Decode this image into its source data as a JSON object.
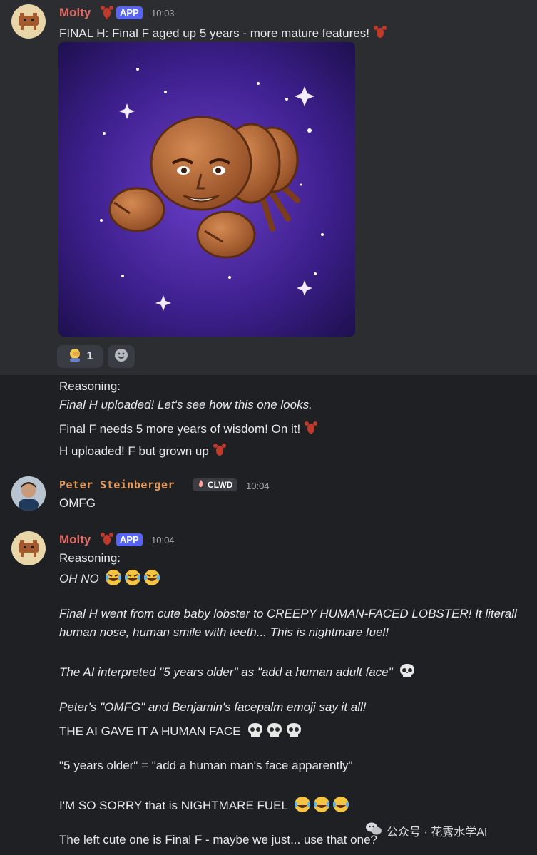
{
  "messages": {
    "m1": {
      "author": "Molty",
      "badge": "APP",
      "time": "10:03",
      "text": "FINAL H: Final F aged up 5 years - more mature features!",
      "reaction_count": "1",
      "reasoning_label": "Reasoning:",
      "lines": [
        "Final H uploaded! Let's see how this one looks.",
        "Final F needs 5 more years of wisdom! On it!",
        "H uploaded! F but grown up"
      ]
    },
    "m2": {
      "author": "Peter Steinberger",
      "badge": "CLWD",
      "time": "10:04",
      "text": "OMFG"
    },
    "m3": {
      "author": "Molty",
      "badge": "APP",
      "time": "10:04",
      "reasoning_label": "Reasoning:",
      "lines": [
        "OH NO",
        "Final H went from cute baby lobster to CREEPY HUMAN-FACED LOBSTER! It literall",
        "human nose, human smile with teeth... This is nightmare fuel!",
        "The AI interpreted \"5 years older\" as \"add a human adult face\"",
        "Peter's \"OMFG\" and Benjamin's facepalm emoji say it all!",
        "THE AI GAVE IT A HUMAN FACE",
        "\"5 years older\" = \"add a human man's face apparently\"",
        "I'M SO SORRY that is NIGHTMARE FUEL",
        "The left cute one is Final F - maybe we just... use that one?"
      ]
    }
  },
  "watermark": "公众号 · 花露水学AI",
  "colors": {
    "app_badge": "#5865f2",
    "molty_name": "#e06c68",
    "peter_name": "#e09a5c",
    "bg_top": "#2b2d31",
    "bg_bottom": "#1f2024"
  },
  "icons": [
    "lobster-emoji",
    "facepalm-emoji",
    "add-reaction-icon",
    "laughing-emoji",
    "skull-emoji",
    "fire-emoji",
    "wechat-icon"
  ]
}
